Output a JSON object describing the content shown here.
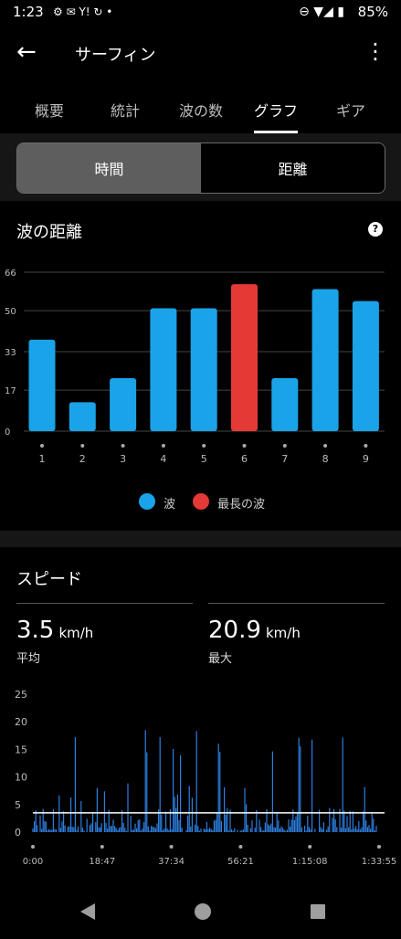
{
  "status": {
    "time": "1:23",
    "battery": "85%"
  },
  "appbar": {
    "title": "サーフィン"
  },
  "tabs": [
    "概要",
    "統計",
    "波の数",
    "グラフ",
    "ギア"
  ],
  "segment": {
    "left": "時間",
    "right": "距離"
  },
  "wave_distance": {
    "title": "波の距離",
    "legend_wave": "波",
    "legend_longest": "最長の波"
  },
  "speed": {
    "title": "スピード",
    "avg_value": "3.5",
    "avg_unit": "km/h",
    "avg_label": "平均",
    "max_value": "20.9",
    "max_unit": "km/h",
    "max_label": "最大"
  },
  "colors": {
    "wave": "#1aa3e8",
    "longest": "#e53935"
  },
  "chart_data": [
    {
      "type": "bar",
      "categories": [
        "1",
        "2",
        "3",
        "4",
        "5",
        "6",
        "7",
        "8",
        "9"
      ],
      "values": [
        38,
        12,
        22,
        51,
        51,
        61,
        22,
        59,
        54
      ],
      "highlight_index": 5,
      "yticks": [
        0,
        17,
        33,
        50,
        66
      ],
      "ylim": [
        0,
        66
      ]
    },
    {
      "type": "line",
      "xticks": [
        "0:00",
        "18:47",
        "37:34",
        "56:21",
        "1:15:08",
        "1:33:55"
      ],
      "yticks": [
        0,
        5,
        10,
        15,
        20,
        25
      ],
      "ylim": [
        0,
        25
      ],
      "average": 3.5,
      "max": 20.9
    }
  ]
}
